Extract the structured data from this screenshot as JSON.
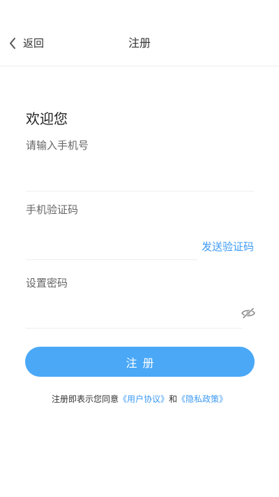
{
  "header": {
    "back_label": "返回",
    "title": "注册"
  },
  "form": {
    "welcome": "欢迎您",
    "phone_label": "请输入手机号",
    "phone_value": "",
    "code_label": "手机验证码",
    "code_value": "",
    "send_code_label": "发送验证码",
    "password_label": "设置密码",
    "password_value": "",
    "submit_label": "注册"
  },
  "agreement": {
    "prefix": "注册即表示您同意",
    "user_agreement": "《用户协议》",
    "conjunction": "和",
    "privacy_policy": "《隐私政策》"
  },
  "icons": {
    "back": "chevron-left-icon",
    "password_visibility": "eye-off-icon"
  },
  "colors": {
    "accent": "#3e9bf4",
    "button": "#4aa8f7",
    "divider": "#eeeeee"
  }
}
